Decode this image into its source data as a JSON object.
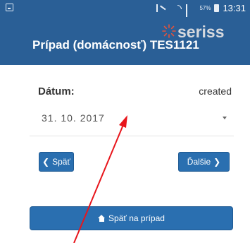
{
  "status_bar": {
    "battery_percent": "57%",
    "time": "13:31",
    "icons": [
      "screenshot-icon",
      "mute-icon",
      "wifi-icon",
      "signal-icon",
      "battery-icon"
    ]
  },
  "app_bar": {
    "title": "Prípad (domácnosť) TES1121",
    "logo_text": "seriss"
  },
  "form": {
    "date_label": "Dátum:",
    "status": "created",
    "date_value": "31. 10. 2017"
  },
  "nav": {
    "back_label": "Späť",
    "next_label": "Ďalšie",
    "case_label": "Späť na prípad"
  },
  "colors": {
    "primary": "#2a5f96",
    "button": "#2a6fb0",
    "annotation": "#e8151b"
  }
}
